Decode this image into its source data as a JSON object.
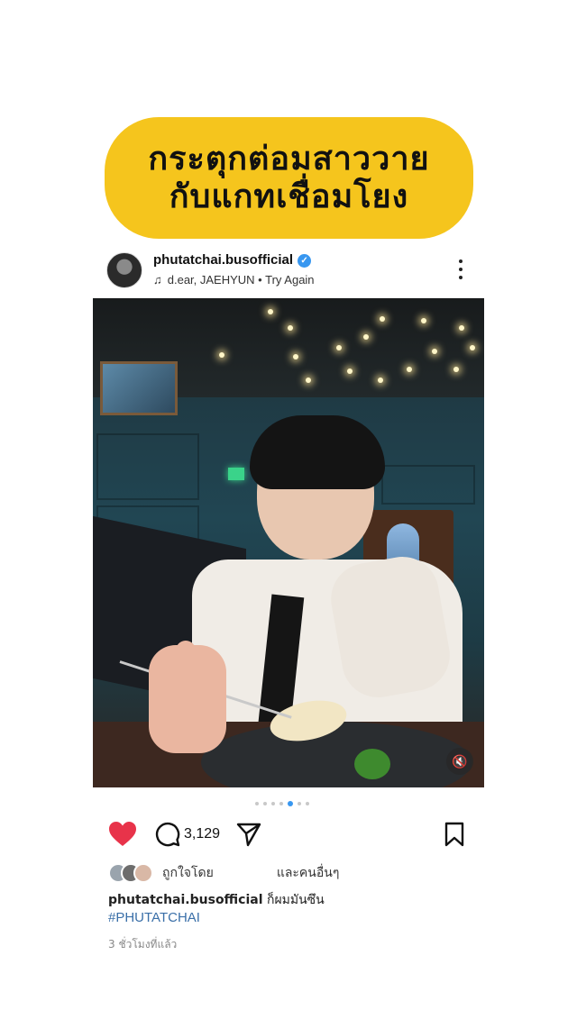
{
  "banner": {
    "line1": "กระตุกต่อมสาววาย",
    "line2": "กับแกทเชื่อมโยง"
  },
  "post": {
    "username": "phutatchai.busofficial",
    "verified": true,
    "music": "d.ear, JAEHYUN • Try Again",
    "carousel": {
      "total": 7,
      "active_index": 4
    },
    "actions": {
      "liked": true,
      "comment_count": "3,129"
    },
    "likes_prefix": "ถูกใจโดย",
    "likes_suffix": "และคนอื่นๆ",
    "caption_user": "phutatchai.busofficial",
    "caption_text": "ก็ผมมันซึน",
    "hashtag": "#PHUTATCHAI",
    "timestamp": "3 ชั่วโมงที่แล้ว"
  },
  "colors": {
    "banner_bg": "#f5c51d",
    "heart": "#e8334a",
    "hashtag": "#3a6fa8",
    "verified": "#3897f0"
  },
  "icons": [
    "music-icon",
    "verified-icon",
    "more-icon",
    "mute-icon",
    "heart-icon",
    "comment-icon",
    "share-icon",
    "save-icon"
  ]
}
